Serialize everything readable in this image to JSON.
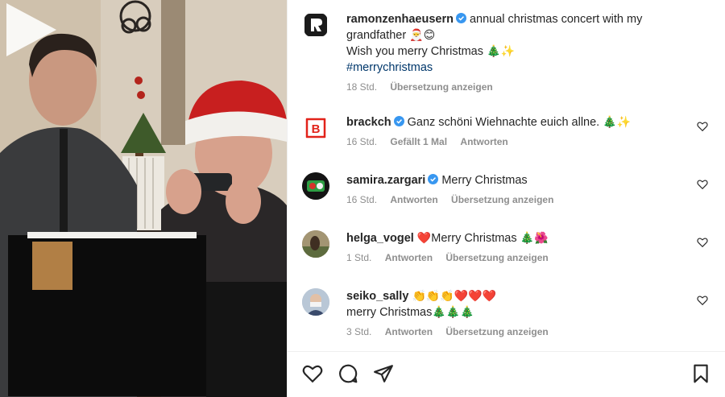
{
  "post": {
    "author": "ramonzenhaeusern",
    "caption_text": "annual christmas concert with my grandfather",
    "caption_emoji": "🎅😊",
    "caption_line2": "Wish you merry Christmas",
    "caption_line2_emoji": "🎄✨",
    "hashtag": "#merrychristmas",
    "time": "18 Std.",
    "translate": "Übersetzung anzeigen"
  },
  "comments": [
    {
      "user": "brackch",
      "verified": true,
      "text": "Ganz schöni Wiehnachte euich allne.",
      "emoji": "🎄✨",
      "time": "16 Std.",
      "likes": "Gefällt 1 Mal",
      "reply": "Antworten",
      "translate": ""
    },
    {
      "user": "samira.zargari",
      "verified": true,
      "text": "Merry Christmas",
      "emoji": "",
      "time": "16 Std.",
      "likes": "",
      "reply": "Antworten",
      "translate": "Übersetzung anzeigen"
    },
    {
      "user": "helga_vogel",
      "verified": false,
      "prefix_emoji": "❤️",
      "text": "Merry Christmas",
      "emoji": "🎄🌺",
      "time": "1 Std.",
      "likes": "",
      "reply": "Antworten",
      "translate": "Übersetzung anzeigen"
    },
    {
      "user": "seiko_sally",
      "verified": false,
      "prefix_emoji": "👏👏👏❤️❤️❤️",
      "text": "merry Christmas",
      "emoji": "🎄🎄🎄",
      "time": "3 Std.",
      "likes": "",
      "reply": "Antworten",
      "translate": "Übersetzung anzeigen"
    }
  ],
  "icons": {
    "like": "heart-icon",
    "comment": "comment-bubble-icon",
    "share": "paper-plane-icon",
    "save": "bookmark-icon",
    "play": "play-icon",
    "verified": "verified-badge-icon"
  },
  "colors": {
    "verified": "#3897f0",
    "hashtag": "#00376b",
    "muted": "#8e8e8e",
    "brack_red": "#e2231a"
  }
}
